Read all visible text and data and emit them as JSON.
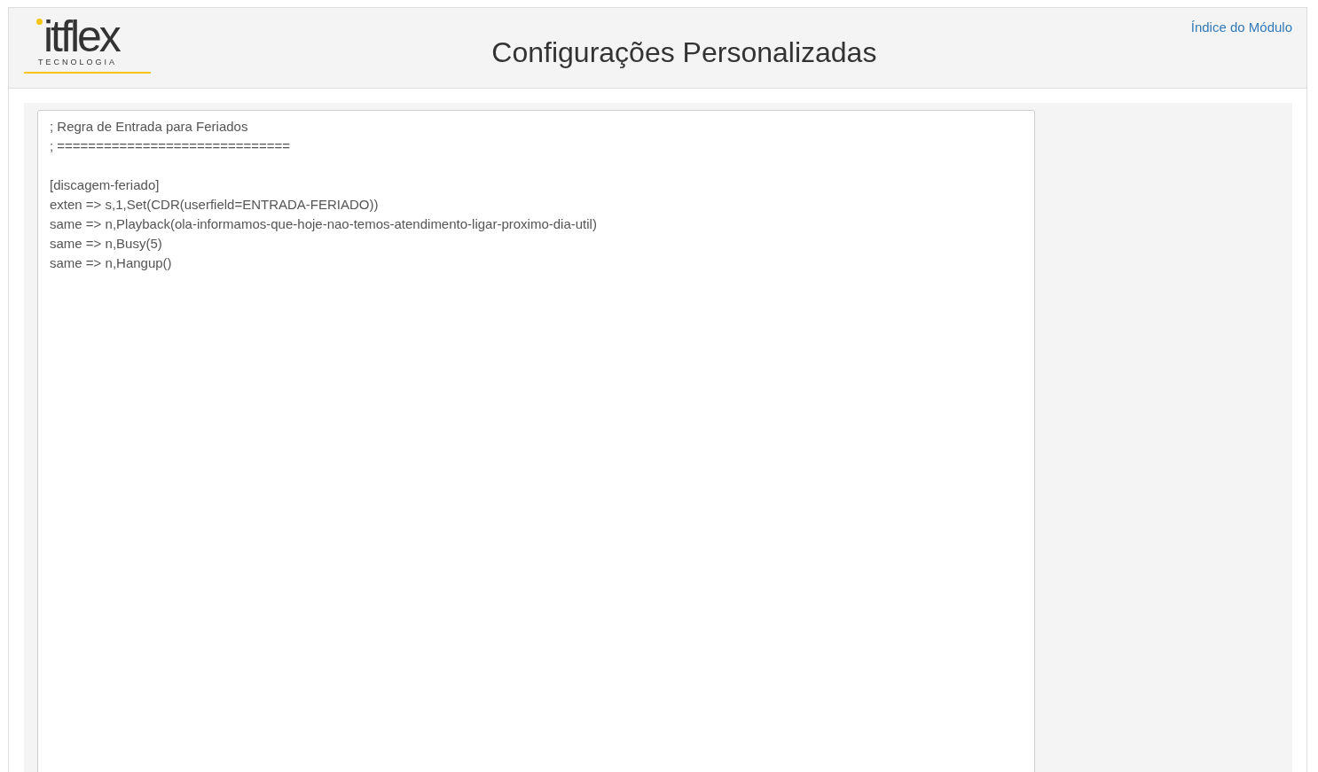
{
  "logo": {
    "name": "itflex",
    "tagline": "TECNOLOGIA"
  },
  "title": "Configurações Personalizadas",
  "module_index_link": "Índice do Módulo",
  "editor": {
    "blocks": [
      [
        "; Regra de Entrada para Feriados",
        "; =============================="
      ],
      [
        "[discagem-feriado]",
        "exten => s,1,Set(CDR(userfield=ENTRADA-FERIADO))",
        "same => n,Playback(ola-informamos-que-hoje-nao-temos-atendimento-ligar-proximo-dia-util)",
        "same => n,Busy(5)",
        "same => n,Hangup()"
      ]
    ]
  }
}
